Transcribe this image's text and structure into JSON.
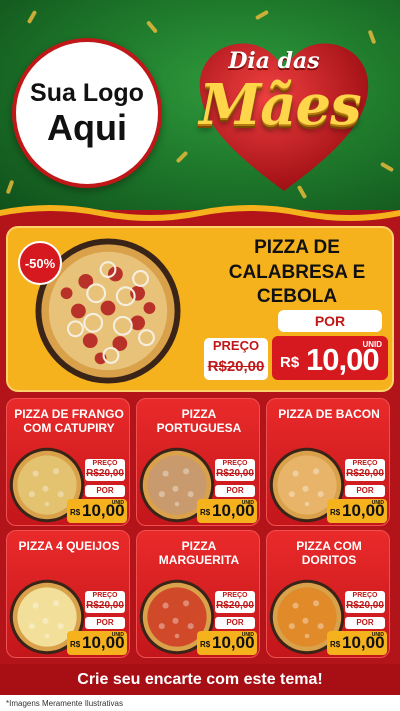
{
  "logo": {
    "line1": "Sua Logo",
    "line2": "Aqui"
  },
  "event": {
    "title_top": "Dia das",
    "title_main": "Mães"
  },
  "featured": {
    "discount": "-50%",
    "name": "PIZZA DE CALABRESA E CEBOLA",
    "preco_label": "PREÇO",
    "old_price": "R$20,00",
    "por_label": "POR",
    "currency": "R$",
    "price": "10,00",
    "unit": "UNID"
  },
  "card_labels": {
    "preco": "PREÇO",
    "por": "POR",
    "currency": "R$",
    "unit": "UNID"
  },
  "cards": [
    {
      "name": "PIZZA DE FRANGO COM CATUPIRY",
      "old_price": "R$20,00",
      "price": "10,00",
      "topping": "#e3c270"
    },
    {
      "name": "PIZZA PORTUGUESA",
      "old_price": "R$20,00",
      "price": "10,00",
      "topping": "#c89a6e"
    },
    {
      "name": "PIZZA DE BACON",
      "old_price": "R$20,00",
      "price": "10,00",
      "topping": "#e8b46a"
    },
    {
      "name": "PIZZA 4 QUEIJOS",
      "old_price": "R$20,00",
      "price": "10,00",
      "topping": "#f2e09a"
    },
    {
      "name": "PIZZA MARGUERITA",
      "old_price": "R$20,00",
      "price": "10,00",
      "topping": "#d04a2a"
    },
    {
      "name": "PIZZA COM DORITOS",
      "old_price": "R$20,00",
      "price": "10,00",
      "topping": "#e08a2a"
    }
  ],
  "cta": "Crie seu encarte com este tema!",
  "footnote": "*Imagens Meramente Ilustrativas",
  "colors": {
    "green": "#1f7a2c",
    "red": "#b3141a",
    "gold": "#f6b21c",
    "card_red": "#d6191e"
  }
}
